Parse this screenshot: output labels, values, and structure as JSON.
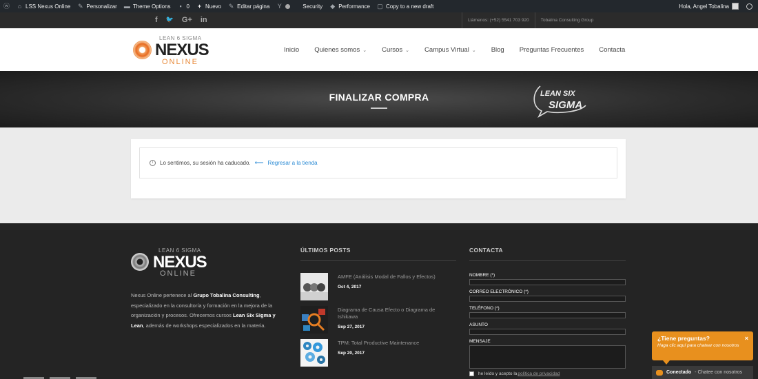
{
  "adminbar": {
    "site_name": "LSS Nexus Online",
    "customize": "Personalizar",
    "theme_options": "Theme Options",
    "comments_count": "0",
    "new": "Nuevo",
    "edit_page": "Editar página",
    "security": "Security",
    "performance": "Performance",
    "copy_draft": "Copy to a new draft",
    "greeting": "Hola, Angel Tobalina"
  },
  "topstrip": {
    "social": [
      "f",
      "🐦",
      "G+",
      "in"
    ],
    "phone": "Llámenos: (+52) 5541 703 920",
    "company": "Tobalina Consulting Group"
  },
  "logo": {
    "tag": "LEAN 6 SIGMA",
    "name": "NEXUS",
    "sub": "ONLINE"
  },
  "nav": {
    "items": [
      {
        "label": "Inicio",
        "dropdown": false
      },
      {
        "label": "Quienes somos",
        "dropdown": true
      },
      {
        "label": "Cursos",
        "dropdown": true
      },
      {
        "label": "Campus Virtual",
        "dropdown": true
      },
      {
        "label": "Blog",
        "dropdown": false
      },
      {
        "label": "Preguntas Frecuentes",
        "dropdown": false
      },
      {
        "label": "Contacta",
        "dropdown": false
      }
    ]
  },
  "hero": {
    "title": "FINALIZAR COMPRA",
    "badge_line1": "LEAN SIX",
    "badge_line2": "SIGMA"
  },
  "notice": {
    "message": "Lo sentimos, su sesión ha caducado.",
    "link": "Regresar a la tienda"
  },
  "footer": {
    "about": {
      "p1": "Nexus Online pertenece al ",
      "company": "Grupo Tobalina Consulting",
      "p2": ", especializado en la consultoría y formación en la mejora de la organización y procesos. Ofrecemos cursos ",
      "courses": "Lean Six Sigma y Lean",
      "p3": ", además de workshops especializados en la materia."
    },
    "posts_heading": "ÚLTIMOS POSTS",
    "posts": [
      {
        "title": "AMFE (Análisis Modal de Fallos y Efectos)",
        "date": "Oct 4, 2017"
      },
      {
        "title": "Diagrama de Causa Efecto o Diagrama de Ishikawa",
        "date": "Sep 27, 2017"
      },
      {
        "title": "TPM: Total Productive Maintenance",
        "date": "Sep 20, 2017"
      }
    ],
    "contact_heading": "CONTACTA",
    "form": {
      "name": "NOMBRE (*)",
      "email": "CORREO ELECTRÓNICO (*)",
      "phone": "TELÉFONO (*)",
      "subject": "ASUNTO",
      "message": "MENSAJE",
      "privacy_pre": "he leído y acepto la ",
      "privacy_link": "política de privacidad"
    }
  },
  "chat": {
    "title": "¿Tiene preguntas?",
    "subtitle": "Haga clic aquí para chatear con nosotros",
    "close": "×",
    "status": "Conectado",
    "status_text": "- Chatee con nosotros"
  },
  "colors": {
    "accent": "#e8901e",
    "link": "#2a8ad4",
    "adminbar": "#23282d",
    "footer": "#242424"
  }
}
